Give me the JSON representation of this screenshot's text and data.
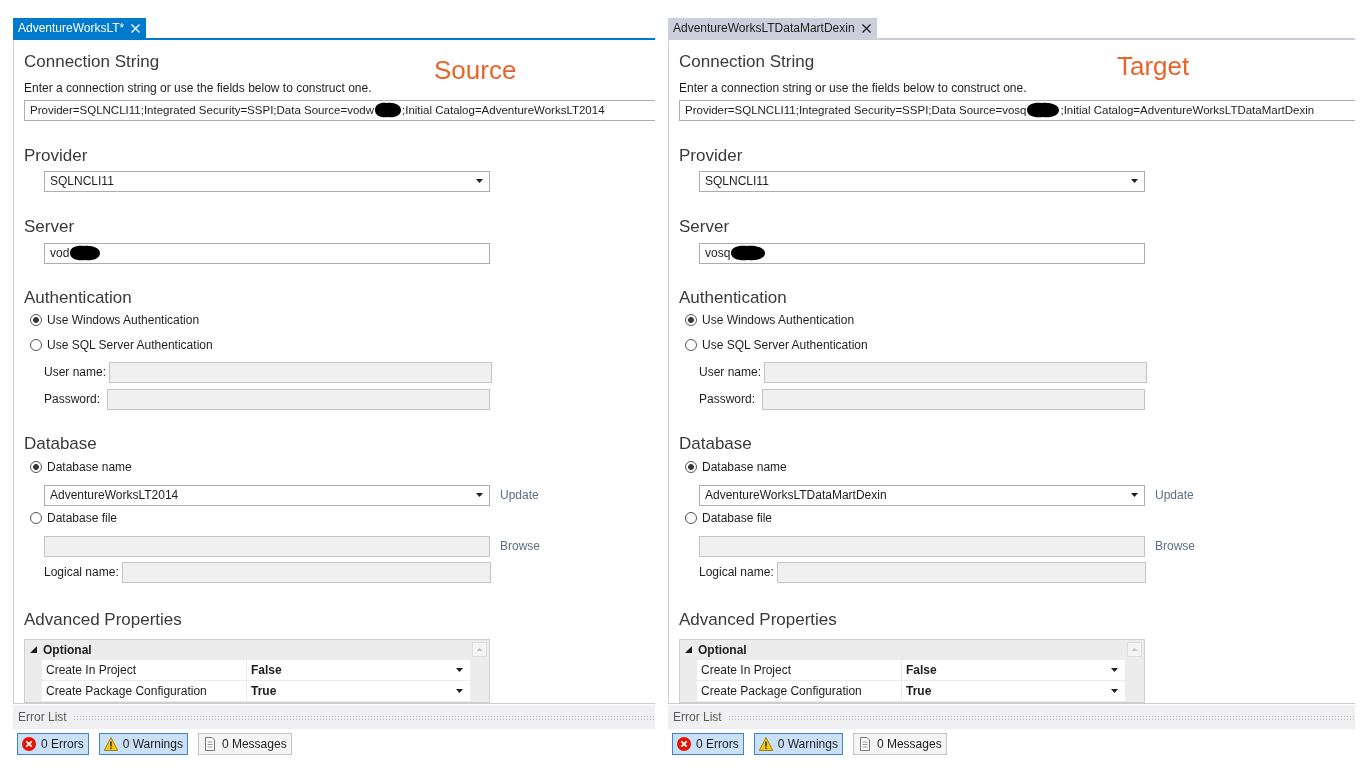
{
  "panels": [
    {
      "tab": {
        "label": "AdventureWorksLT*",
        "active": true
      },
      "caption": "Source",
      "connection_string": {
        "heading": "Connection String",
        "hint": "Enter a connection string or use the fields below to construct one.",
        "segments": [
          {
            "kind": "text",
            "text": "Provider=SQLNCLI11;Integrated Security=SSPI;Data Source=vodw"
          },
          {
            "kind": "redaction"
          },
          {
            "kind": "text",
            "text": ";Initial Catalog=AdventureWorksLT2014"
          }
        ]
      },
      "provider": {
        "heading": "Provider",
        "value": "SQLNCLI11"
      },
      "server": {
        "heading": "Server",
        "segments": [
          {
            "kind": "text",
            "text": "vod"
          },
          {
            "kind": "redaction"
          }
        ]
      },
      "authentication": {
        "heading": "Authentication",
        "options": [
          {
            "label": "Use Windows Authentication",
            "selected": true
          },
          {
            "label": "Use SQL Server Authentication",
            "selected": false
          }
        ],
        "credentials": [
          {
            "label": "User name:",
            "disabled": true
          },
          {
            "label": "Password:",
            "disabled": true
          }
        ]
      },
      "database": {
        "heading": "Database",
        "options": [
          {
            "label": "Database name",
            "selected": true
          },
          {
            "label": "Database file",
            "selected": false
          }
        ],
        "name": {
          "value": "AdventureWorksLT2014",
          "link": "Update"
        },
        "file": {
          "disabled": true,
          "link": "Browse"
        },
        "logical_name": {
          "label": "Logical name:",
          "disabled": true
        }
      },
      "advanced_properties": {
        "heading": "Advanced Properties",
        "category": {
          "label": "Optional",
          "expanded": true
        },
        "rows": [
          {
            "name": "Create In Project",
            "value": "False"
          },
          {
            "name": "Create Package Configuration",
            "value": "True"
          }
        ]
      },
      "error_list": {
        "title": "Error List",
        "filters": [
          {
            "kind": "errors",
            "label": "0 Errors",
            "selected": true
          },
          {
            "kind": "warnings",
            "label": "0 Warnings",
            "selected": true
          },
          {
            "kind": "messages",
            "label": "0 Messages",
            "selected": false
          }
        ]
      }
    },
    {
      "tab": {
        "label": "AdventureWorksLTDataMartDexin",
        "active": false
      },
      "caption": "Target",
      "connection_string": {
        "heading": "Connection String",
        "hint": "Enter a connection string or use the fields below to construct one.",
        "segments": [
          {
            "kind": "text",
            "text": "Provider=SQLNCLI11;Integrated Security=SSPI;Data Source=vosq"
          },
          {
            "kind": "redaction"
          },
          {
            "kind": "text",
            "text": ";Initial Catalog=AdventureWorksLTDataMartDexin"
          }
        ]
      },
      "provider": {
        "heading": "Provider",
        "value": "SQLNCLI11"
      },
      "server": {
        "heading": "Server",
        "segments": [
          {
            "kind": "text",
            "text": "vosq"
          },
          {
            "kind": "redaction"
          }
        ]
      },
      "authentication": {
        "heading": "Authentication",
        "options": [
          {
            "label": "Use Windows Authentication",
            "selected": true
          },
          {
            "label": "Use SQL Server Authentication",
            "selected": false
          }
        ],
        "credentials": [
          {
            "label": "User name:",
            "disabled": true
          },
          {
            "label": "Password:",
            "disabled": true
          }
        ]
      },
      "database": {
        "heading": "Database",
        "options": [
          {
            "label": "Database name",
            "selected": true
          },
          {
            "label": "Database file",
            "selected": false
          }
        ],
        "name": {
          "value": "AdventureWorksLTDataMartDexin",
          "link": "Update"
        },
        "file": {
          "disabled": true,
          "link": "Browse"
        },
        "logical_name": {
          "label": "Logical name:",
          "disabled": true
        }
      },
      "advanced_properties": {
        "heading": "Advanced Properties",
        "category": {
          "label": "Optional",
          "expanded": true
        },
        "rows": [
          {
            "name": "Create In Project",
            "value": "False"
          },
          {
            "name": "Create Package Configuration",
            "value": "True"
          }
        ]
      },
      "error_list": {
        "title": "Error List",
        "filters": [
          {
            "kind": "errors",
            "label": "0 Errors",
            "selected": true
          },
          {
            "kind": "warnings",
            "label": "0 Warnings",
            "selected": true
          },
          {
            "kind": "messages",
            "label": "0 Messages",
            "selected": false
          }
        ]
      }
    }
  ]
}
